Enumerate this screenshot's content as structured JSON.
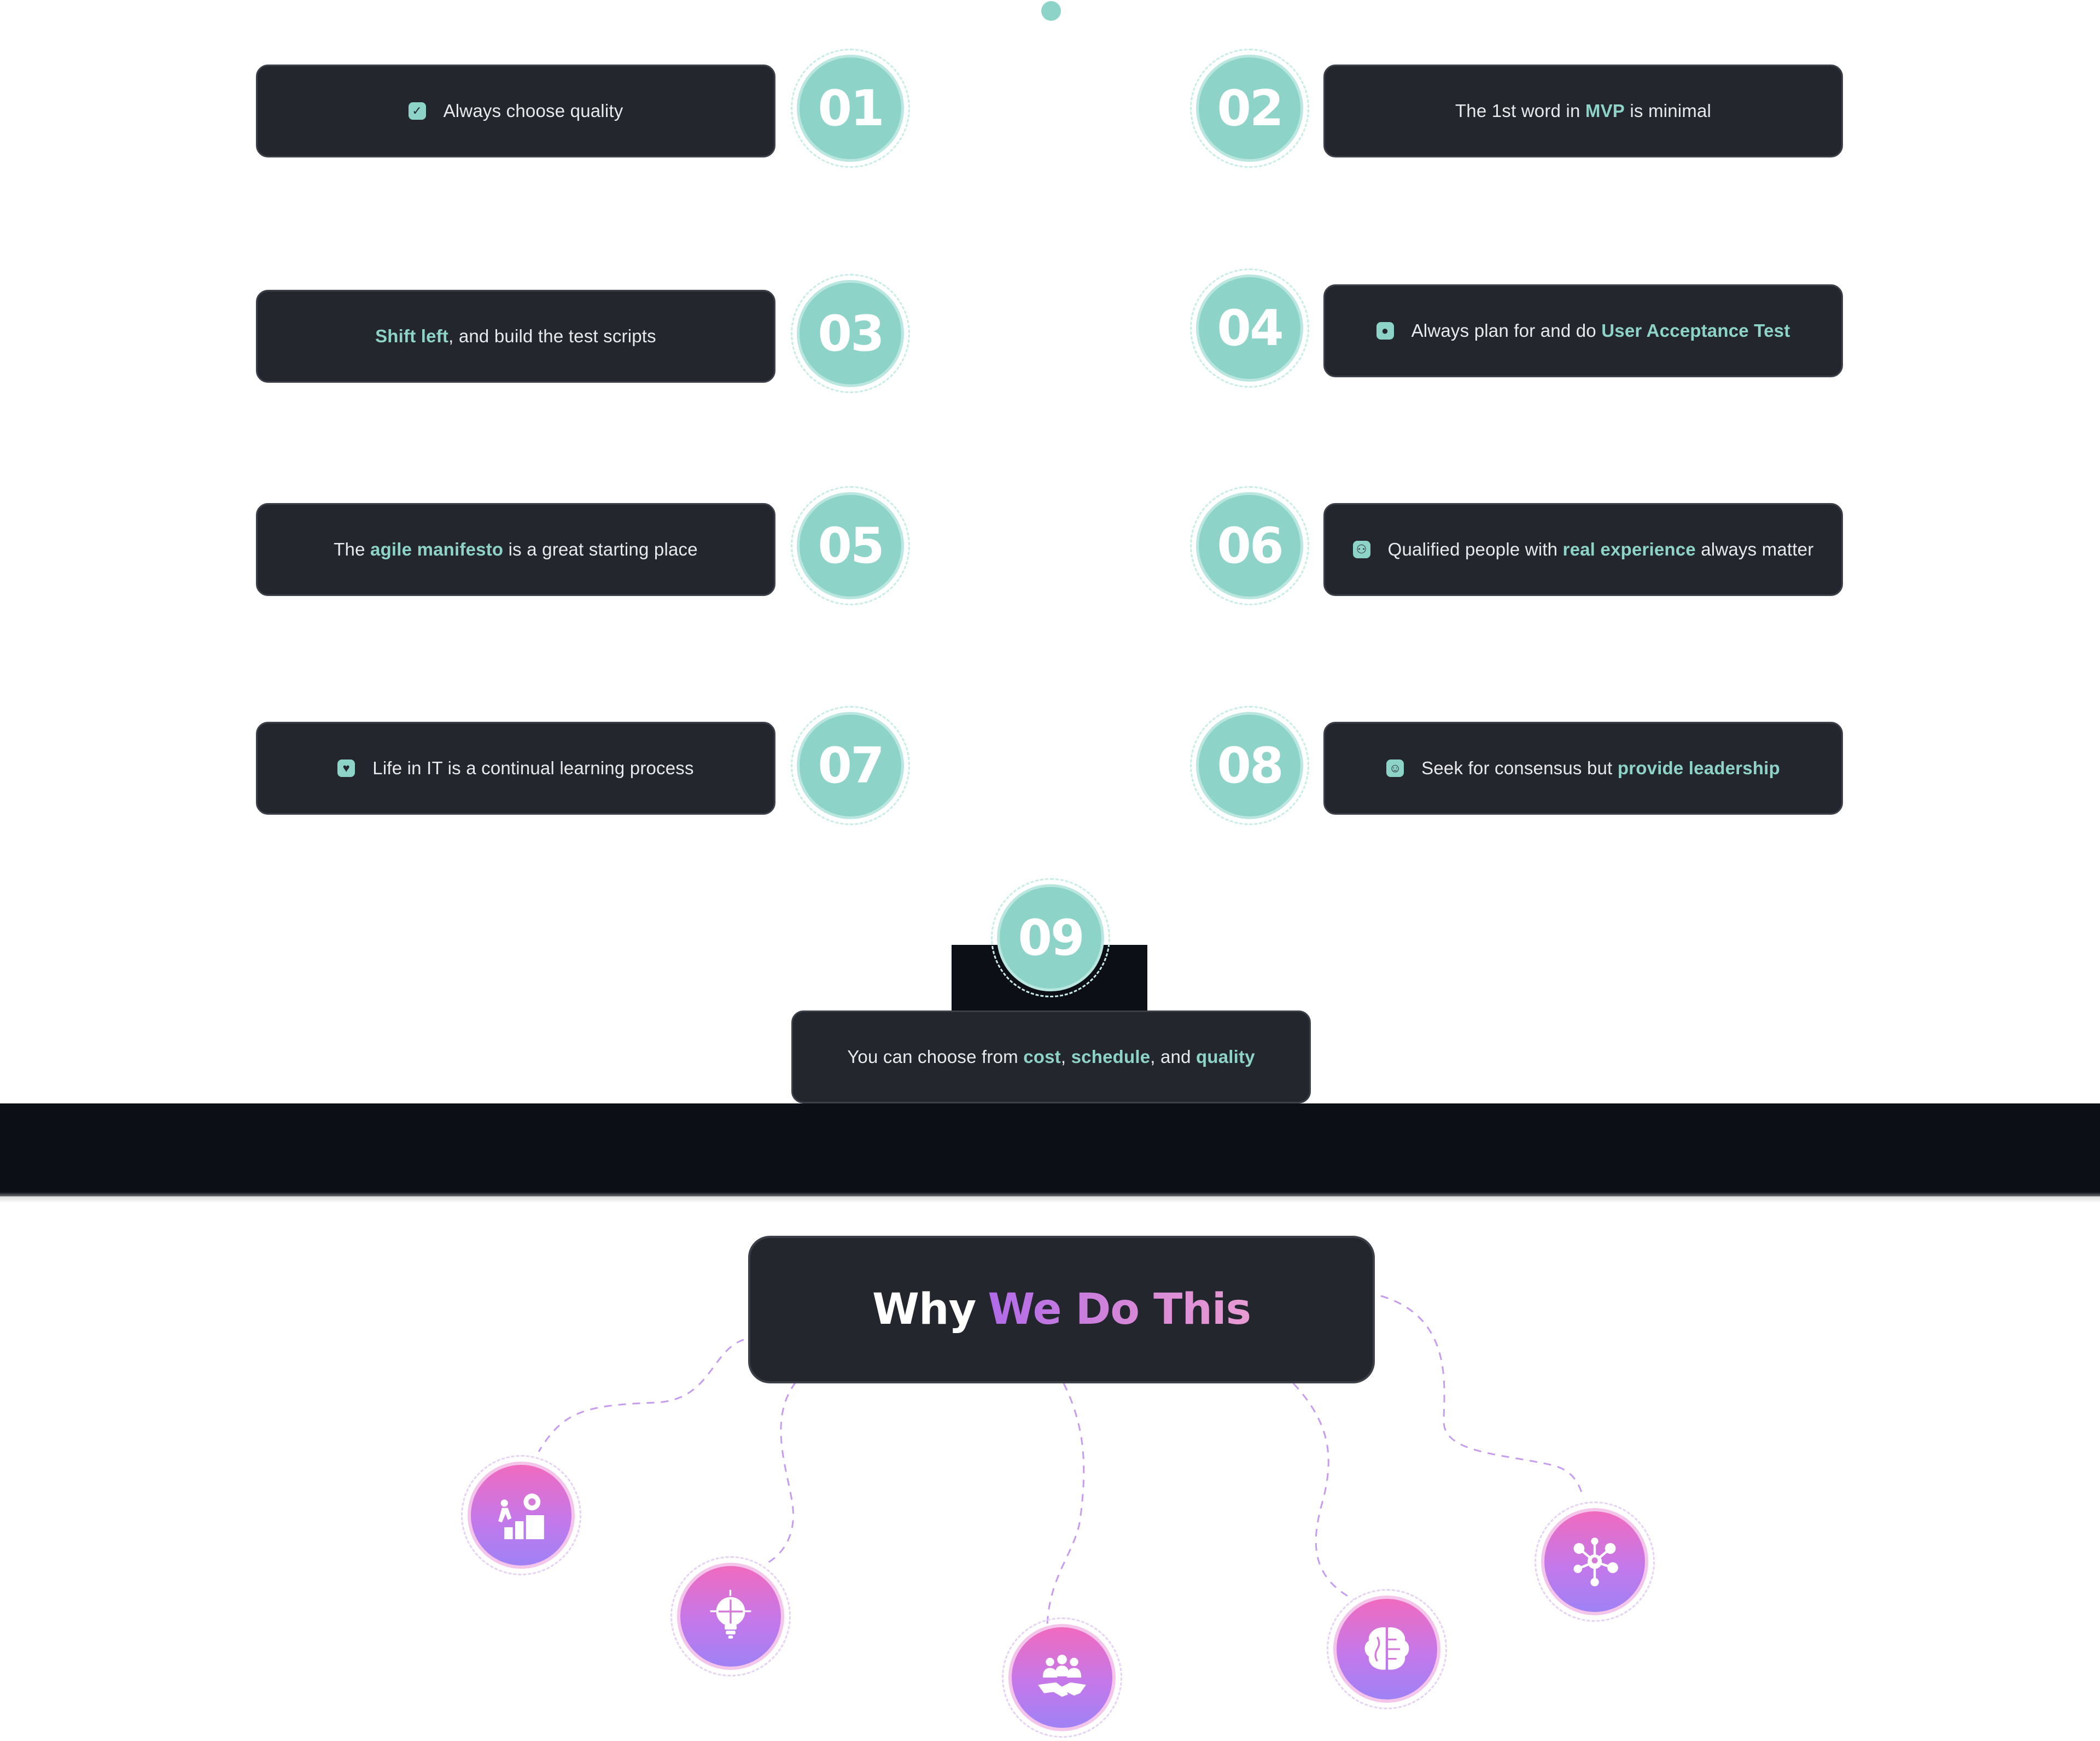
{
  "principles": [
    {
      "number": "01",
      "icon": "check-square-icon",
      "parts": [
        "Always choose quality"
      ]
    },
    {
      "number": "02",
      "icon": "",
      "parts": [
        "The 1st word in ",
        "MVP",
        " is minimal"
      ]
    },
    {
      "number": "03",
      "icon": "",
      "parts": [
        "Shift left",
        ", and build the test scripts"
      ]
    },
    {
      "number": "04",
      "icon": "user-badge-icon",
      "parts": [
        "Always plan for and do ",
        "User Acceptance Test"
      ]
    },
    {
      "number": "05",
      "icon": "",
      "parts": [
        "The ",
        "agile manifesto",
        " is a great starting place"
      ]
    },
    {
      "number": "06",
      "icon": "people-icon",
      "parts": [
        "Qualified people with ",
        "real experience",
        " always matter"
      ]
    },
    {
      "number": "07",
      "icon": "heart-icon",
      "parts": [
        "Life in IT is a continual learning process"
      ]
    },
    {
      "number": "08",
      "icon": "group-icon",
      "parts": [
        "Seek for consensus but ",
        "provide leadership"
      ]
    },
    {
      "number": "09",
      "icon": "",
      "parts": [
        "You can choose from ",
        "cost",
        ", ",
        "schedule",
        ", and ",
        "quality"
      ]
    }
  ],
  "why": {
    "title_plain": "Why",
    "title_gradient": "We Do This",
    "icons": [
      "growth-steps-gear-icon",
      "lightbulb-puzzle-icon",
      "handshake-team-icon",
      "brain-circuit-icon",
      "network-people-icon"
    ]
  },
  "colors": {
    "accent_teal": "#8dd3c7",
    "card_bg": "#23262d",
    "dark_band": "#0c0f16",
    "gradient_pink": "#f06bbf",
    "gradient_purple": "#9f82f5"
  }
}
